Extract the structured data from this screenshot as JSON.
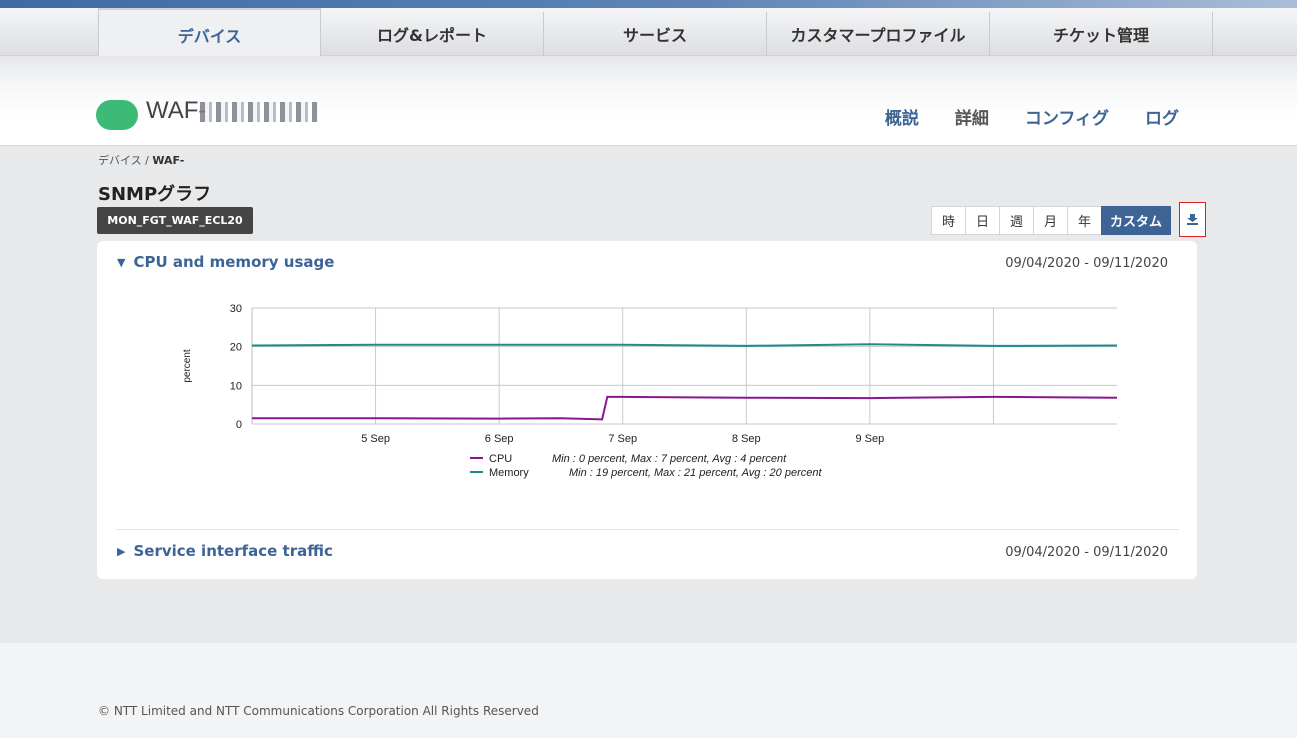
{
  "main_nav": {
    "tabs": [
      "デバイス",
      "ログ&レポート",
      "サービス",
      "カスタマープロファイル",
      "チケット管理"
    ]
  },
  "device": {
    "name_prefix": "WAF-",
    "status_color": "#3dba75"
  },
  "sub_nav": [
    "概説",
    "詳細",
    "コンフィグ",
    "ログ"
  ],
  "breadcrumb": {
    "root": "デバイス",
    "separator": "/",
    "current": "WAF-"
  },
  "page": {
    "title": "SNMPグラフ",
    "monitor_tag": "MON_FGT_WAF_ECL20"
  },
  "time_ranges": [
    "時",
    "日",
    "週",
    "月",
    "年",
    "カスタム"
  ],
  "selected_range": "カスタム",
  "sections": [
    {
      "title": "CPU and memory usage",
      "date_range": "09/04/2020 - 09/11/2020",
      "expanded": true
    },
    {
      "title": "Service interface traffic",
      "date_range": "09/04/2020 - 09/11/2020",
      "expanded": false
    }
  ],
  "chart_data": {
    "type": "line",
    "title": "",
    "xlabel": "",
    "ylabel": "percent",
    "ylim": [
      0,
      30
    ],
    "yticks": [
      0,
      10,
      20,
      30
    ],
    "x_range": [
      "2020-09-04",
      "2020-09-11"
    ],
    "x_tick_labels": [
      "5 Sep",
      "6 Sep",
      "7 Sep",
      "8 Sep",
      "9 Sep"
    ],
    "grid": true,
    "legend_position": "bottom",
    "series": [
      {
        "name": "CPU",
        "color": "#8b168f",
        "stats": "Min : 0 percent, Max : 7 percent, Avg : 4 percent",
        "x": [
          "2020-09-04",
          "2020-09-05",
          "2020-09-06",
          "2020-09-06 12:00",
          "2020-09-06 20:00",
          "2020-09-06 21:00",
          "2020-09-07",
          "2020-09-08",
          "2020-09-09",
          "2020-09-10",
          "2020-09-11"
        ],
        "values": [
          1.5,
          1.5,
          1.4,
          1.5,
          1.2,
          7.0,
          7.0,
          6.8,
          6.7,
          7.0,
          6.8
        ]
      },
      {
        "name": "Memory",
        "color": "#1c8b8b",
        "stats": "Min : 19 percent, Max : 21 percent, Avg : 20 percent",
        "x": [
          "2020-09-04",
          "2020-09-05",
          "2020-09-06",
          "2020-09-07",
          "2020-09-08",
          "2020-09-09",
          "2020-09-10",
          "2020-09-11"
        ],
        "values": [
          20.3,
          20.5,
          20.5,
          20.5,
          20.2,
          20.6,
          20.2,
          20.3
        ]
      }
    ]
  },
  "footer": {
    "copyright": "© NTT Limited and NTT Communications Corporation All Rights Reserved"
  }
}
